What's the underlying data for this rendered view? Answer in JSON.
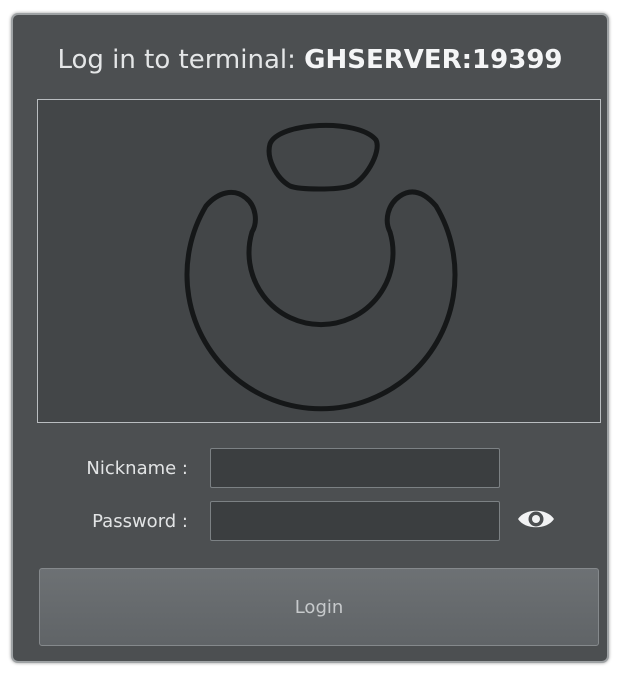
{
  "dialog": {
    "title_prefix": "Log in to terminal: ",
    "terminal_name": "GHSERVER:19399"
  },
  "logo": {
    "icon": "app-logo"
  },
  "form": {
    "nickname_label": "Nickname :",
    "nickname_value": "",
    "password_label": "Password :",
    "password_value": "",
    "show_password_icon": "eye-icon"
  },
  "actions": {
    "login_label": "Login"
  }
}
